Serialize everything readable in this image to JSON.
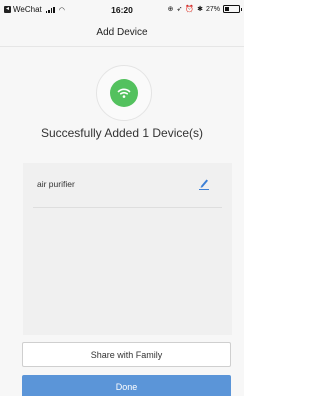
{
  "status_bar": {
    "carrier": "WeChat",
    "time": "16:20",
    "battery": "27%"
  },
  "nav": {
    "title": "Add Device"
  },
  "success": {
    "message": "Succesfully Added 1 Device(s)"
  },
  "devices": [
    {
      "name": "air purifier"
    }
  ],
  "buttons": {
    "share_label": "Share with Family",
    "done_label": "Done"
  },
  "colors": {
    "success_green": "#53c15e",
    "edit_blue": "#3b7fd6",
    "primary_button": "#5b95d8"
  },
  "icons": {
    "wifi_badge": "wifi-icon",
    "edit": "pencil-icon"
  }
}
